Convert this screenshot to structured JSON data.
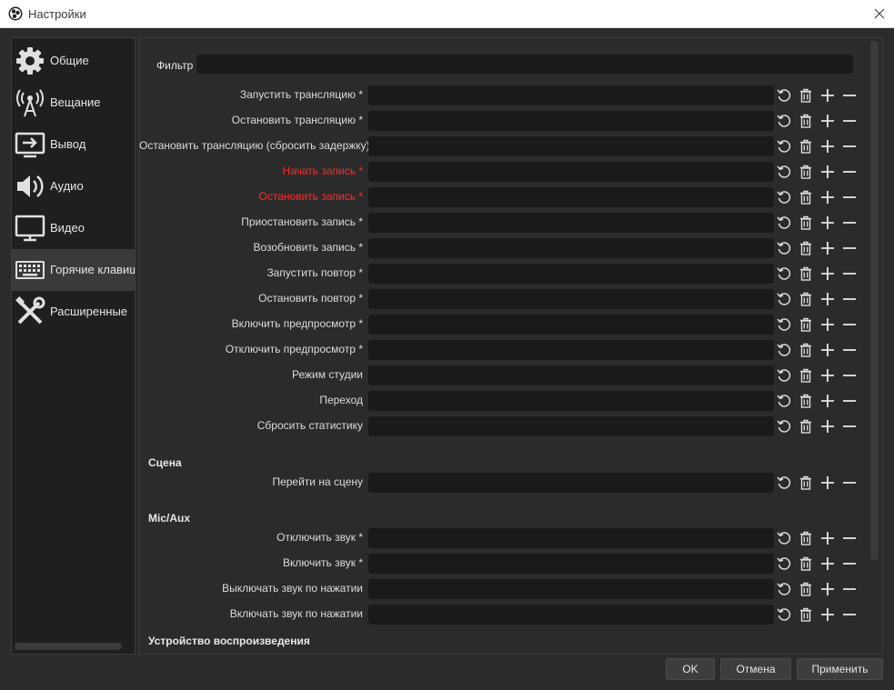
{
  "window": {
    "title": "Настройки"
  },
  "sidebar": {
    "items": [
      {
        "label": "Общие",
        "icon": "gear-icon"
      },
      {
        "label": "Вещание",
        "icon": "antenna-icon"
      },
      {
        "label": "Вывод",
        "icon": "output-icon"
      },
      {
        "label": "Аудио",
        "icon": "speaker-icon"
      },
      {
        "label": "Видео",
        "icon": "monitor-icon"
      },
      {
        "label": "Горячие клавиш",
        "icon": "keyboard-icon",
        "active": true
      },
      {
        "label": "Расширенные",
        "icon": "tools-icon"
      }
    ]
  },
  "filter": {
    "label": "Фильтр",
    "value": ""
  },
  "hotkeys": [
    {
      "label": "Запустить трансляцию *"
    },
    {
      "label": "Остановить трансляцию *"
    },
    {
      "label": "Остановить трансляцию (сбросить задержку)"
    },
    {
      "label": "Начать запись *",
      "highlight": true
    },
    {
      "label": "Остановить запись *",
      "highlight": true
    },
    {
      "label": "Приостановить запись *"
    },
    {
      "label": "Возобновить запись *"
    },
    {
      "label": "Запустить повтор *"
    },
    {
      "label": "Остановить повтор *"
    },
    {
      "label": "Включить предпросмотр *"
    },
    {
      "label": "Отключить предпросмотр *"
    },
    {
      "label": "Режим студии"
    },
    {
      "label": "Переход"
    },
    {
      "label": "Сбросить статистику"
    }
  ],
  "sections": [
    {
      "title": "Сцена",
      "rows": [
        {
          "label": "Перейти на сцену"
        }
      ]
    },
    {
      "title": "Mic/Aux",
      "rows": [
        {
          "label": "Отключить звук *"
        },
        {
          "label": "Включить звук *"
        },
        {
          "label": "Выключать звук по нажатии"
        },
        {
          "label": "Включать звук по нажатии"
        }
      ]
    },
    {
      "title": "Устройство воспроизведения",
      "rows": []
    }
  ],
  "colors": {
    "highlight": "#ff2b2b",
    "background": "#2b2b2b",
    "input": "#1a1a1a"
  },
  "buttons": {
    "ok": "OK",
    "cancel": "Отмена",
    "apply": "Применить"
  }
}
